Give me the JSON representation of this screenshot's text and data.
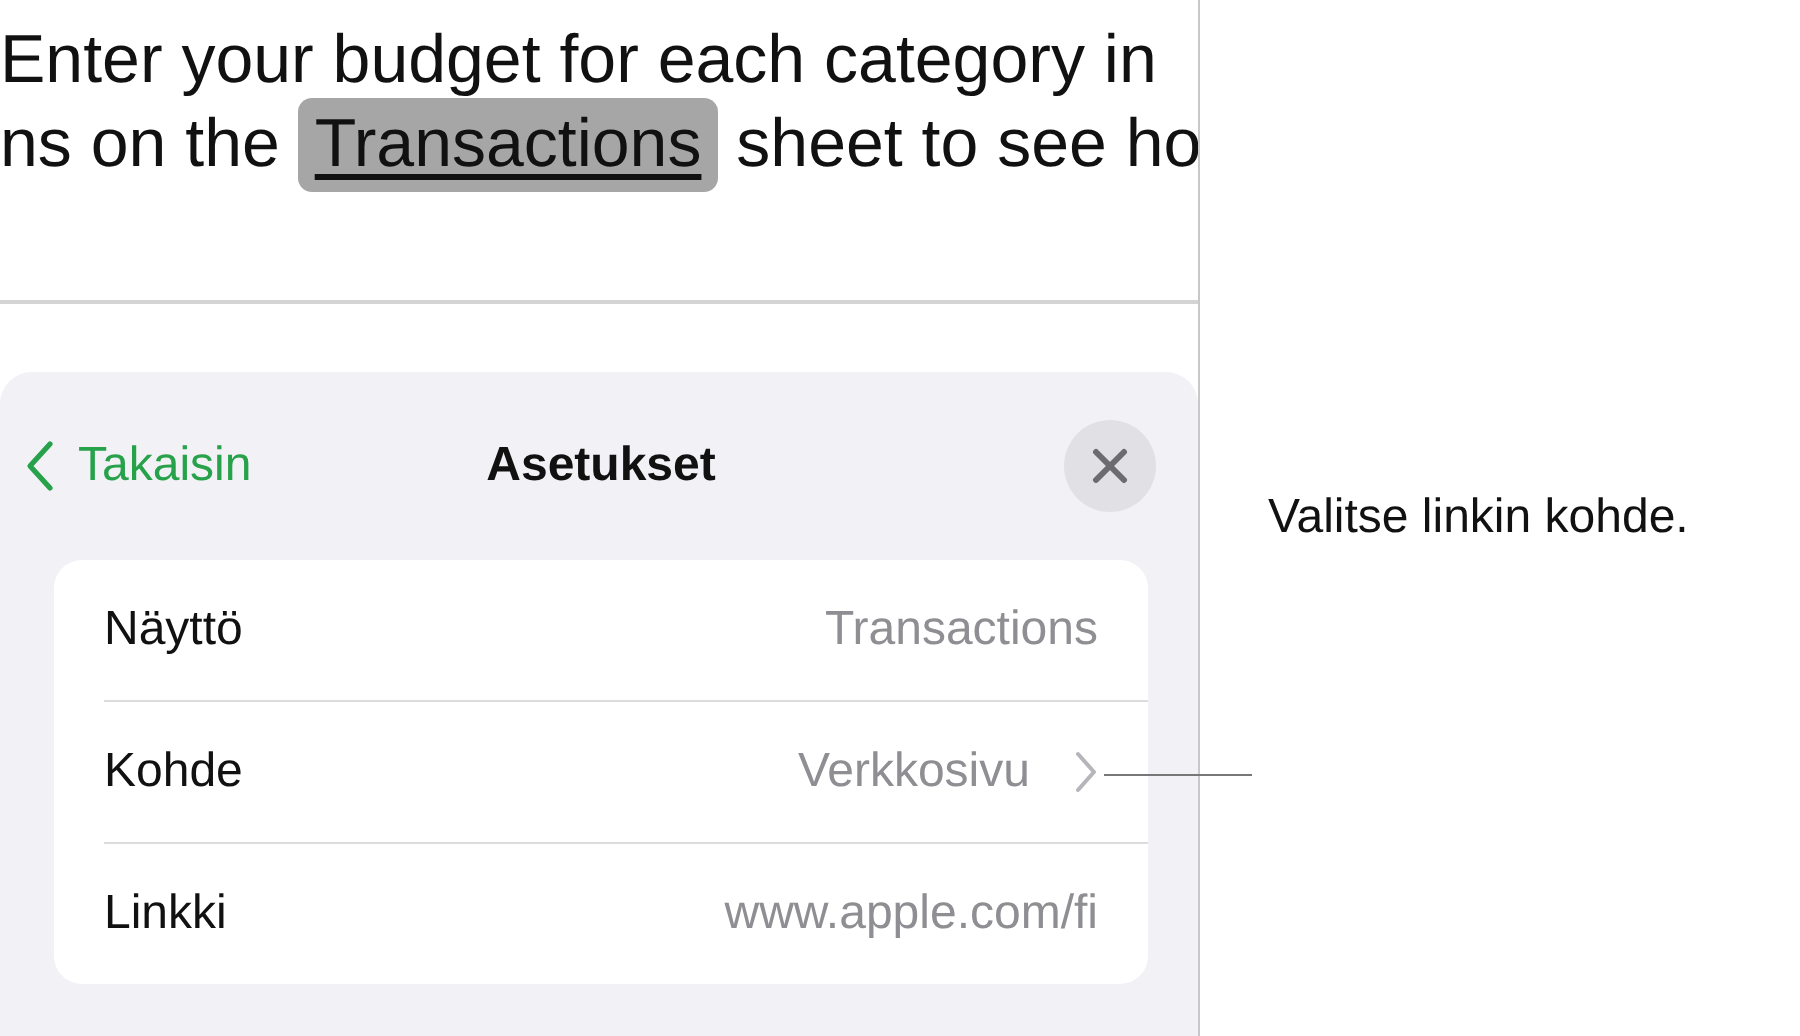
{
  "document": {
    "line_1": "Enter your budget for each category in",
    "line_2": {
      "before": "ns on the ",
      "link": {
        "text": "Transactions",
        "selected": true
      },
      "after": " sheet to see ho"
    }
  },
  "panel": {
    "back_button": "Takaisin",
    "title": "Asetukset",
    "rows": [
      {
        "label": "Näyttö",
        "value": "Transactions",
        "kind": "text"
      },
      {
        "label": "Kohde",
        "value": "Verkkosivu",
        "kind": "nav"
      },
      {
        "label": "Linkki",
        "value": "www.apple.com/fi",
        "kind": "text"
      }
    ]
  },
  "callout": "Valitse linkin kohde."
}
